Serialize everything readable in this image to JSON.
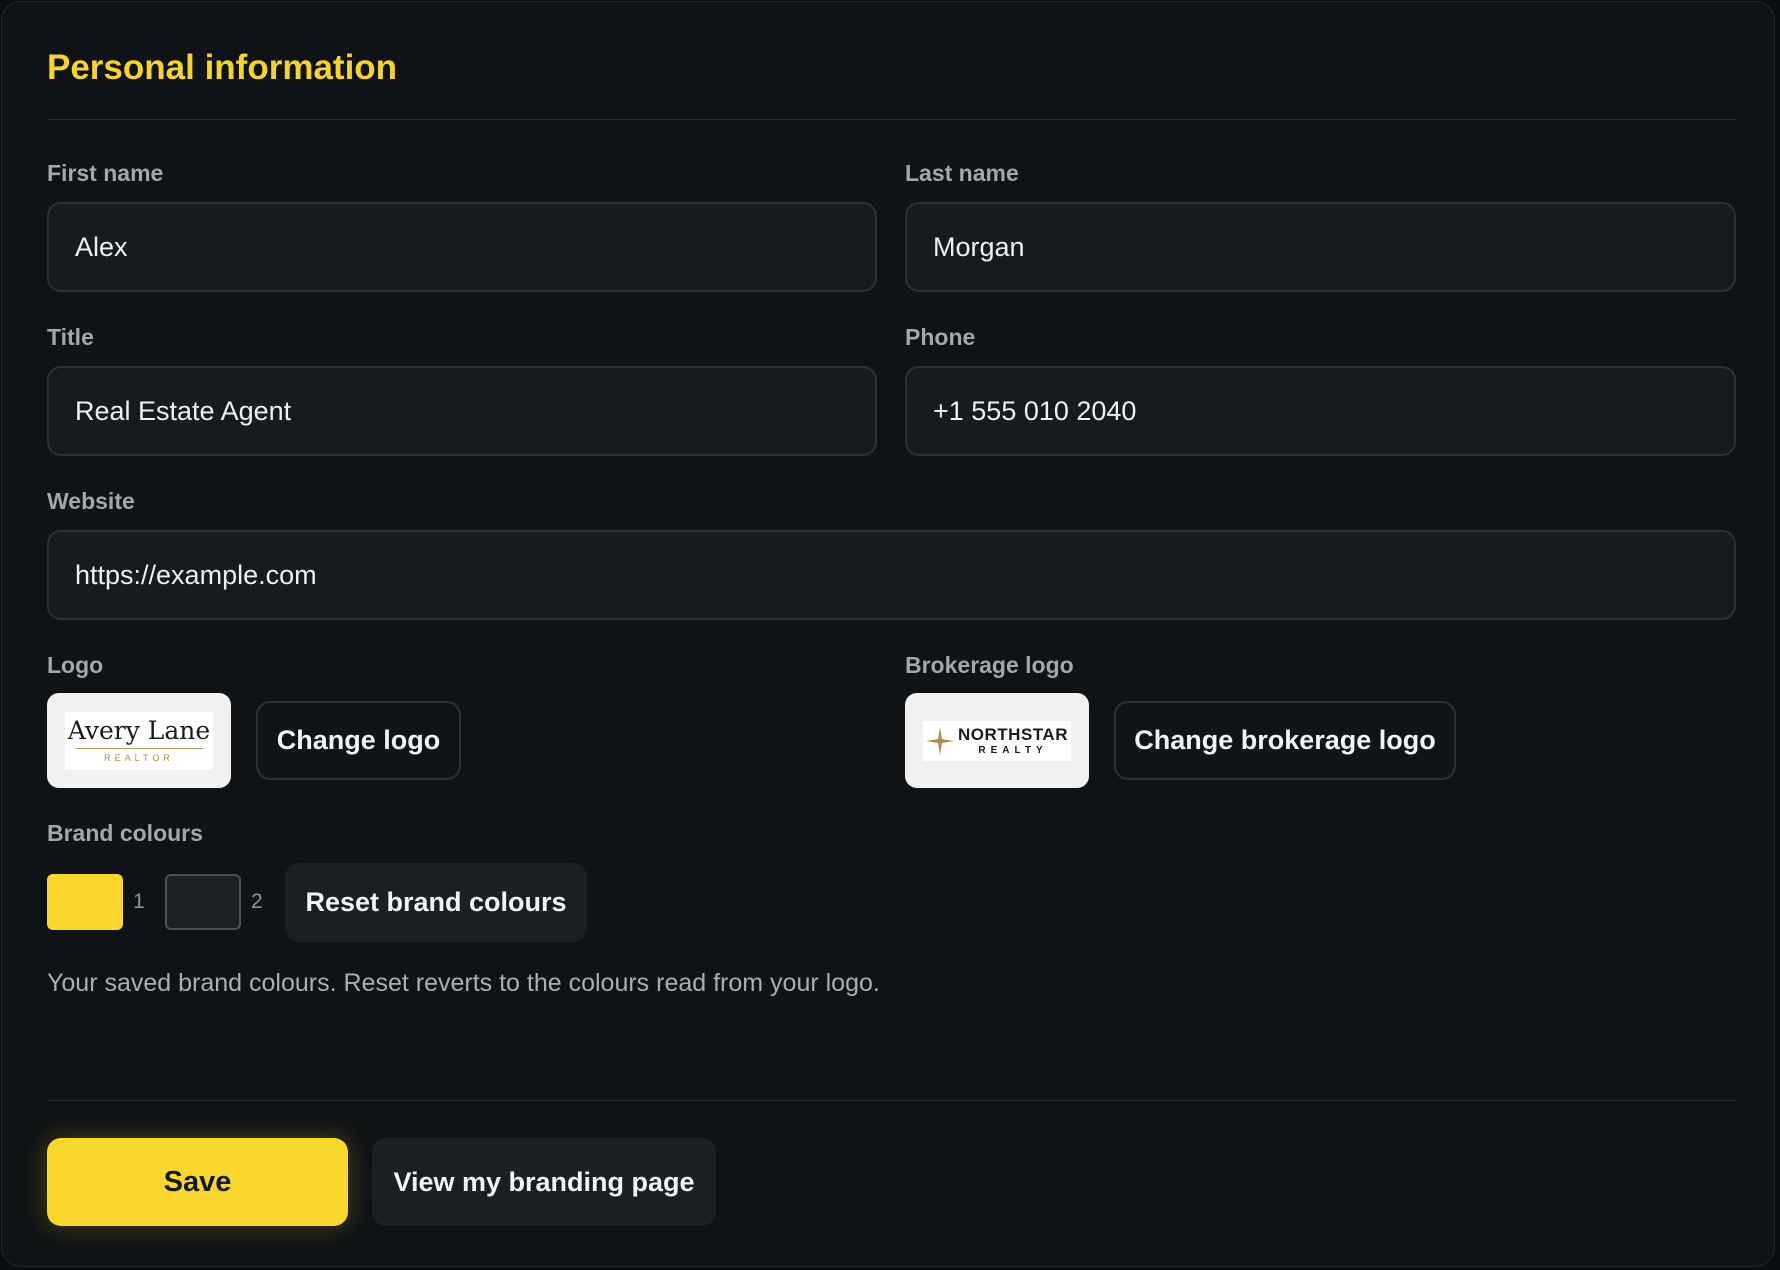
{
  "section": {
    "title": "Personal information"
  },
  "fields": {
    "first_name": {
      "label": "First name",
      "value": "Alex"
    },
    "last_name": {
      "label": "Last name",
      "value": "Morgan"
    },
    "title": {
      "label": "Title",
      "value": "Real Estate Agent"
    },
    "phone": {
      "label": "Phone",
      "value": "+1 555 010 2040"
    },
    "website": {
      "label": "Website",
      "value": "https://example.com"
    }
  },
  "logo": {
    "label": "Logo",
    "image_text": {
      "name": "Avery Lane",
      "subtitle": "REALTOR"
    },
    "change_button": "Change logo"
  },
  "brokerage_logo": {
    "label": "Brokerage logo",
    "image_text": {
      "name": "NORTHSTAR",
      "subtitle": "REALTY"
    },
    "change_button": "Change brokerage logo"
  },
  "brand_colours": {
    "label": "Brand colours",
    "swatches": [
      {
        "index": "1",
        "color": "#fad72c"
      },
      {
        "index": "2",
        "color": "#1c2124"
      }
    ],
    "reset_button": "Reset brand colours",
    "help_text": "Your saved brand colours. Reset reverts to the colours read from your logo."
  },
  "actions": {
    "save_label": "Save",
    "view_branding_label": "View my branding page"
  },
  "colors": {
    "accent": "#fad72c",
    "background": "#0f1315",
    "field_background": "#171b1e"
  }
}
